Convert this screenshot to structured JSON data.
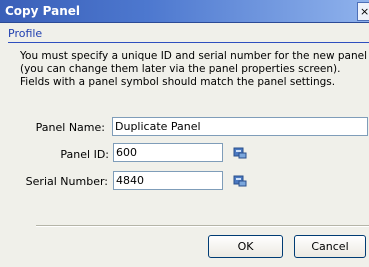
{
  "window": {
    "title": "Copy Panel",
    "close_label": "×"
  },
  "tab": {
    "label": "Profile"
  },
  "instructions": "You must specify a unique ID and serial number for the new panel (you can change them later via the panel properties screen). Fields with a panel symbol should match the panel settings.",
  "fields": {
    "panel_name": {
      "label": "Panel Name:",
      "value": "Duplicate Panel"
    },
    "panel_id": {
      "label": "Panel ID:",
      "value": "600"
    },
    "serial_number": {
      "label": "Serial Number:",
      "value": "4840"
    }
  },
  "buttons": {
    "ok": "OK",
    "cancel": "Cancel"
  },
  "icons": {
    "panel_symbol": "panel-symbol-icon"
  }
}
